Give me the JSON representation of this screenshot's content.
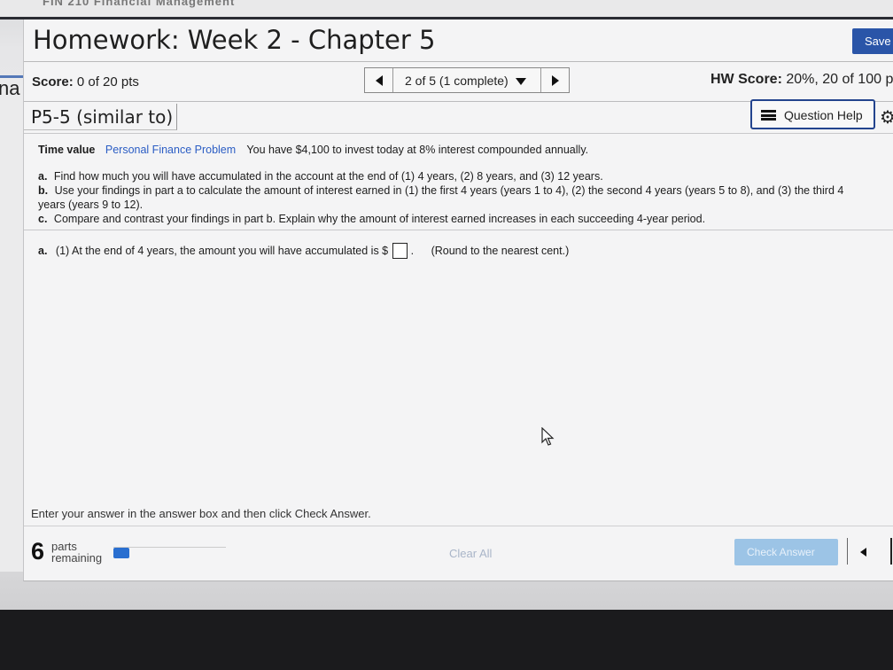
{
  "page": {
    "title": "Homework: Week 2 - Chapter 5",
    "save_label": "Save",
    "left_fragment": "na"
  },
  "header": {
    "score_label": "Score:",
    "score_value": "0 of 20 pts",
    "pager_label": "2 of 5 (1 complete)",
    "hw_score_label": "HW Score:",
    "hw_score_value": "20%, 20 of 100 p"
  },
  "question": {
    "id": "P5-5 (similar to)",
    "help_label": "Question Help",
    "topic": "Time value",
    "category_link": "Personal Finance Problem",
    "intro": "You have $4,100 to invest today at 8% interest compounded annually.",
    "items": [
      {
        "letter": "a.",
        "text": "Find how much you will have accumulated in the account at the end of (1) 4 years, (2) 8 years, and (3) 12 years."
      },
      {
        "letter": "b.",
        "text": "Use your findings in part a to calculate the amount of interest earned in (1) the first 4 years (years 1 to 4), (2) the second 4 years (years 5 to 8), and (3) the third 4",
        "cont": "years (years 9 to 12)."
      },
      {
        "letter": "c.",
        "text": "Compare and contrast your findings in part b. Explain why the amount of interest earned increases in each succeeding 4-year period."
      }
    ],
    "answer_letter": "a.",
    "answer_prompt": "(1) At the end of 4 years, the amount you will have accumulated is $",
    "answer_value": "",
    "answer_hint": "(Round to the nearest cent.)"
  },
  "footer": {
    "instructions": "Enter your answer in the answer box and then click Check Answer.",
    "parts_count": "6",
    "parts_label": "parts remaining",
    "progress_fraction": 0.14,
    "clear_all_label": "Clear All",
    "check_answer_label": "Check Answer"
  },
  "colors": {
    "accent": "#2a55a8",
    "link": "#2b5dc4",
    "progress": "#2a6fd0",
    "check_disabled": "#9cc4e6"
  }
}
